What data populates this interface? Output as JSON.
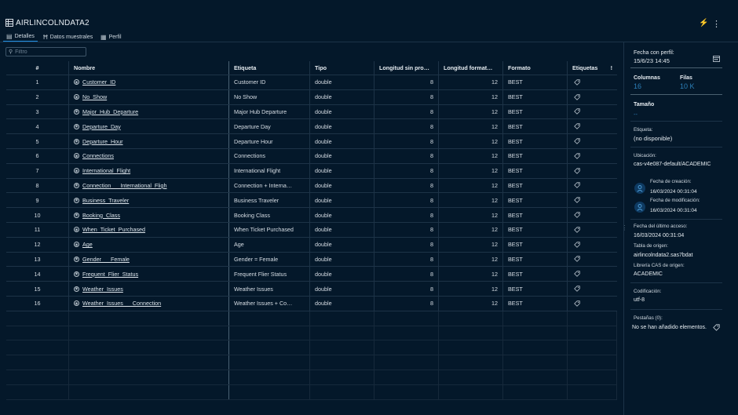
{
  "app": {
    "title": "AIRLINCOLNDATA2",
    "icon": "table-icon"
  },
  "tabs": [
    {
      "label": "Detalles",
      "icon": "details-icon"
    },
    {
      "label": "Datos muestrales",
      "icon": "sample-data-icon"
    },
    {
      "label": "Perfil",
      "icon": "profile-icon"
    }
  ],
  "filter": {
    "placeholder": "Filtro",
    "value": ""
  },
  "table": {
    "headers": {
      "num": "#",
      "name": "Nombre",
      "label": "Etiqueta",
      "type": "Tipo",
      "raw_len": "Longitud sin pro…",
      "fmt_len": "Longitud format…",
      "format": "Formato",
      "tags": "Etiquetas",
      "alert": "!"
    },
    "rows": [
      {
        "num": "1",
        "name": "Customer_ID",
        "label": "Customer ID",
        "type": "double",
        "raw_len": "8",
        "fmt_len": "12",
        "format": "BEST"
      },
      {
        "num": "2",
        "name": "No_Show",
        "label": "No Show",
        "type": "double",
        "raw_len": "8",
        "fmt_len": "12",
        "format": "BEST"
      },
      {
        "num": "3",
        "name": "Major_Hub_Departure",
        "label": "Major Hub Departure",
        "type": "double",
        "raw_len": "8",
        "fmt_len": "12",
        "format": "BEST"
      },
      {
        "num": "4",
        "name": "Departure_Day",
        "label": "Departure Day",
        "type": "double",
        "raw_len": "8",
        "fmt_len": "12",
        "format": "BEST"
      },
      {
        "num": "5",
        "name": "Departure_Hour",
        "label": "Departure Hour",
        "type": "double",
        "raw_len": "8",
        "fmt_len": "12",
        "format": "BEST"
      },
      {
        "num": "6",
        "name": "Connections",
        "label": "Connections",
        "type": "double",
        "raw_len": "8",
        "fmt_len": "12",
        "format": "BEST"
      },
      {
        "num": "7",
        "name": "International_Flight",
        "label": "International Flight",
        "type": "double",
        "raw_len": "8",
        "fmt_len": "12",
        "format": "BEST"
      },
      {
        "num": "8",
        "name": "Connection___International_Fligh",
        "label": "Connection + Interna…",
        "type": "double",
        "raw_len": "8",
        "fmt_len": "12",
        "format": "BEST"
      },
      {
        "num": "9",
        "name": "Business_Traveler",
        "label": "Business Traveler",
        "type": "double",
        "raw_len": "8",
        "fmt_len": "12",
        "format": "BEST"
      },
      {
        "num": "10",
        "name": "Booking_Class",
        "label": "Booking Class",
        "type": "double",
        "raw_len": "8",
        "fmt_len": "12",
        "format": "BEST"
      },
      {
        "num": "11",
        "name": "When_Ticket_Purchased",
        "label": "When Ticket Purchased",
        "type": "double",
        "raw_len": "8",
        "fmt_len": "12",
        "format": "BEST"
      },
      {
        "num": "12",
        "name": "Age",
        "label": "Age",
        "type": "double",
        "raw_len": "8",
        "fmt_len": "12",
        "format": "BEST"
      },
      {
        "num": "13",
        "name": "Gender___Female",
        "label": "Gender = Female",
        "type": "double",
        "raw_len": "8",
        "fmt_len": "12",
        "format": "BEST"
      },
      {
        "num": "14",
        "name": "Frequent_Flier_Status",
        "label": "Frequent Flier Status",
        "type": "double",
        "raw_len": "8",
        "fmt_len": "12",
        "format": "BEST"
      },
      {
        "num": "15",
        "name": "Weather_Issues",
        "label": "Weather Issues",
        "type": "double",
        "raw_len": "8",
        "fmt_len": "12",
        "format": "BEST"
      },
      {
        "num": "16",
        "name": "Weather_Issues___Connection",
        "label": "Weather Issues + Co…",
        "type": "double",
        "raw_len": "8",
        "fmt_len": "12",
        "format": "BEST"
      }
    ]
  },
  "panel": {
    "profile_date_label": "Fecha con perfil:",
    "profile_date": "15/6/23 14:45",
    "columns_label": "Columnas",
    "columns_value": "16",
    "rows_label": "Filas",
    "rows_value": "10 K",
    "size_label": "Tamaño",
    "size_value": "--",
    "label_label": "Etiqueta:",
    "label_value": "(no disponible)",
    "location_label": "Ubicación:",
    "location_value": "cas-v4e087-default/ACADEMIC",
    "created_label": "Fecha de creación:",
    "created_value": "16/03/2024 00:31:04",
    "modified_label": "Fecha de modificación:",
    "modified_value": "16/03/2024 00:31:04",
    "last_access_label": "Fecha del último acceso:",
    "last_access_value": "16/03/2024 00:31:04",
    "source_table_label": "Tabla de origen:",
    "source_table_value": "airlincolndata2.sas7bdat",
    "source_lib_label": "Librería CAS de origen:",
    "source_lib_value": "ACADEMIC",
    "encoding_label": "Codificación:",
    "encoding_value": "utf-8",
    "tags_label": "Pestañas (0):",
    "tags_value": "No se han añadido elementos."
  },
  "colors": {
    "background": "#04182a",
    "accent": "#1f8fe6",
    "stat": "#2c7fb8",
    "flash": "#3fbf4a"
  }
}
